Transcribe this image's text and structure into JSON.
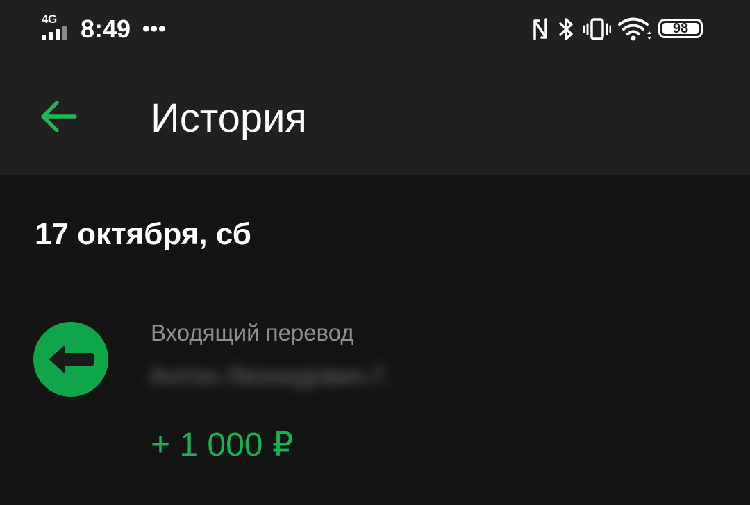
{
  "status_bar": {
    "network": "4G",
    "time": "8:49",
    "dots": "•••",
    "battery": "98",
    "icons": [
      "nfc-icon",
      "bluetooth-icon",
      "vibrate-icon",
      "wifi-icon",
      "battery-icon"
    ]
  },
  "header": {
    "title": "История",
    "back_icon": "arrow-left-icon",
    "accent_color": "#1db954"
  },
  "history": {
    "date": "17 октября, сб",
    "transactions": [
      {
        "type": "Входящий перевод",
        "name": "Антон Леонидович Г.",
        "amount": "+ 1 000 ₽",
        "icon": "incoming-transfer-icon",
        "icon_color": "#0fa64a",
        "amount_color": "#15b553"
      }
    ]
  }
}
